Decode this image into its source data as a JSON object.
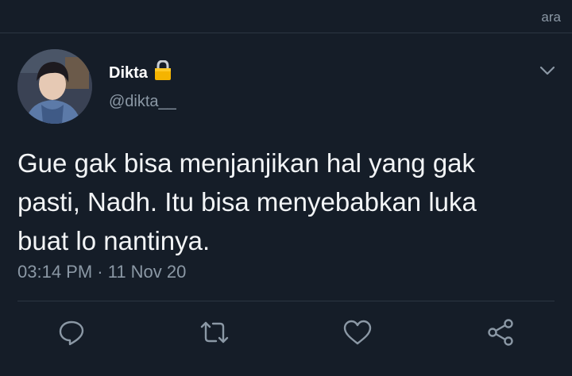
{
  "topbar": {
    "text": "ara"
  },
  "tweet": {
    "display_name": "Dikta",
    "handle": "@dikta__",
    "text": "Gue gak bisa menjanjikan hal yang gak\npasti, Nadh. Itu bisa menyebabkan luka\nbuat lo nantinya.",
    "timestamp": "03:14 PM · 11 Nov 20"
  },
  "icons": {
    "lock": "lock-icon",
    "chevron": "chevron-down-icon",
    "reply": "reply-icon",
    "retweet": "retweet-icon",
    "like": "heart-icon",
    "share": "share-icon"
  },
  "colors": {
    "background": "#151d28",
    "secondary_text": "#8b98a5",
    "divider": "#2b3642",
    "lock": "#f5b400"
  }
}
